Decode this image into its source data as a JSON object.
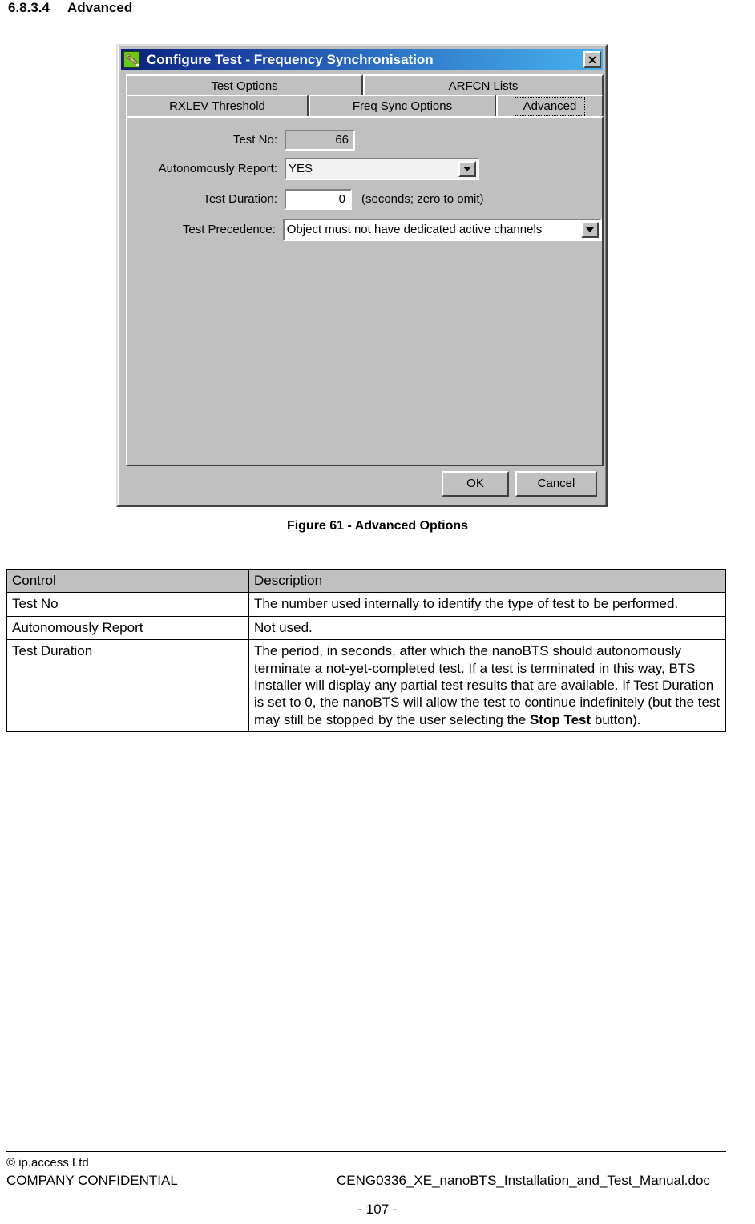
{
  "heading": {
    "number": "6.8.3.4",
    "text": "Advanced"
  },
  "dialog": {
    "title": "Configure Test - Frequency Synchronisation",
    "icon": "bone-icon",
    "close_label": "✕",
    "tabs_top": [
      {
        "label": "Test Options",
        "selected": false
      },
      {
        "label": "ARFCN Lists",
        "selected": false
      }
    ],
    "tabs_bottom": [
      {
        "label": "RXLEV Threshold",
        "selected": false
      },
      {
        "label": "Freq Sync Options",
        "selected": false
      },
      {
        "label": "Advanced",
        "selected": true
      }
    ],
    "fields": {
      "test_no": {
        "label": "Test No:",
        "value": "66"
      },
      "autonomously_report": {
        "label": "Autonomously Report:",
        "value": "YES",
        "dropdown_icon": "chevron-down-icon"
      },
      "test_duration": {
        "label": "Test Duration:",
        "value": "0",
        "hint": "(seconds; zero to omit)"
      },
      "test_precedence": {
        "label": "Test Precedence:",
        "value": "Object must not have dedicated active channels",
        "dropdown_icon": "chevron-down-icon"
      }
    },
    "buttons": {
      "ok": "OK",
      "cancel": "Cancel"
    },
    "colors": {
      "face": "#c0c0c0",
      "title_start": "#08217a",
      "title_end": "#49b0ef",
      "icon_green": "#6fc41a"
    }
  },
  "figure": {
    "caption": "Figure 61 - Advanced Options"
  },
  "table": {
    "headers": [
      "Control",
      "Description"
    ],
    "rows": [
      {
        "control": "Test No",
        "description": "The number used internally to identify the type of test to be performed.",
        "description_bold": "",
        "description_tail": ""
      },
      {
        "control": "Autonomously Report",
        "description": "Not used.",
        "description_bold": "",
        "description_tail": ""
      },
      {
        "control": "Test Duration",
        "description": "The period, in seconds, after which the nanoBTS should autonomously terminate a not-yet-completed test. If a test is terminated in this way, BTS Installer will display any partial test results that are available. If Test Duration is set to 0, the nanoBTS will allow the test to continue indefinitely (but the test may still be stopped by the user selecting the ",
        "description_bold": "Stop Test",
        "description_tail": " button)."
      }
    ]
  },
  "footer": {
    "copyright": "© ip.access Ltd",
    "confidential": "COMPANY CONFIDENTIAL",
    "document": "CENG0336_XE_nanoBTS_Installation_and_Test_Manual.doc",
    "page": "- 107 -"
  }
}
